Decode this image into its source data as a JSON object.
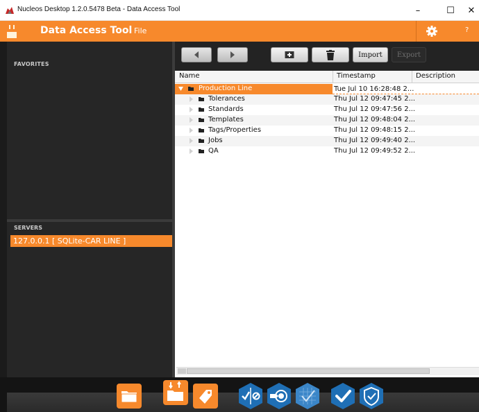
{
  "window": {
    "title": "Nucleos Desktop  1.2.0.5478 Beta - Data Access Tool",
    "minimize": "–",
    "maximize": "☐",
    "close": "✕"
  },
  "appbar": {
    "title": "Data Access Tool",
    "menu_file": "File",
    "help": "?"
  },
  "sidebar": {
    "favorites_label": "FAVORITES",
    "servers_label": "SERVERS",
    "servers": [
      "127.0.0.1 [ SQLite-CAR LINE ]"
    ]
  },
  "toolbar": {
    "import_label": "Import",
    "export_label": "Export"
  },
  "table": {
    "columns": [
      "Name",
      "Timestamp",
      "Description"
    ],
    "rows": [
      {
        "name": "Production Line",
        "timestamp": "Tue Jul 10 16:28:48 2...",
        "description": "",
        "expanded": true,
        "selected": true
      },
      {
        "name": "Tolerances",
        "timestamp": "Thu Jul 12 09:47:45 2...",
        "description": ""
      },
      {
        "name": "Standards",
        "timestamp": "Thu Jul 12 09:47:56 2...",
        "description": ""
      },
      {
        "name": "Templates",
        "timestamp": "Thu Jul 12 09:48:04 2...",
        "description": ""
      },
      {
        "name": "Tags/Properties",
        "timestamp": "Thu Jul 12 09:48:15 2...",
        "description": ""
      },
      {
        "name": "Jobs",
        "timestamp": "Thu Jul 12 09:49:40 2...",
        "description": ""
      },
      {
        "name": "QA",
        "timestamp": "Thu Jul 12 09:49:52 2...",
        "description": ""
      }
    ]
  },
  "colors": {
    "accent": "#f7892c",
    "dock_blue": "#1f6fb5",
    "dark_panel": "#262626"
  },
  "dock": {
    "icons": [
      "folder-icon",
      "folder-transfer-icon",
      "tag-icon",
      "check-cancel-icon",
      "target-icon",
      "blueprint-check-icon",
      "checkmark-icon",
      "shield-check-icon"
    ]
  }
}
